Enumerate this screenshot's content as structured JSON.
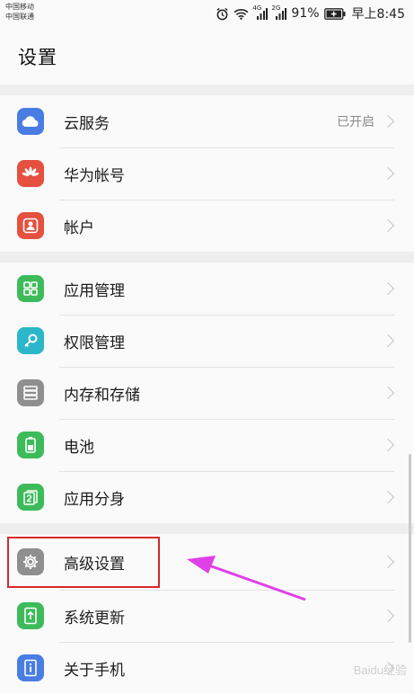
{
  "status_bar": {
    "carrier_1": "中国移动",
    "carrier_2": "中国联通",
    "net_1": "4G",
    "net_2": "2G",
    "battery_pct": "91%",
    "time": "早上8:45"
  },
  "header": {
    "title": "设置"
  },
  "groups": [
    {
      "items": [
        {
          "label": "云服务",
          "status": "已开启",
          "icon": "cloud-icon",
          "color": "#4a7de3"
        },
        {
          "label": "华为帐号",
          "status": "",
          "icon": "huawei-logo-icon",
          "color": "#e5503f"
        },
        {
          "label": "帐户",
          "status": "",
          "icon": "account-icon",
          "color": "#e5503f"
        }
      ]
    },
    {
      "items": [
        {
          "label": "应用管理",
          "status": "",
          "icon": "apps-grid-icon",
          "color": "#3dbb5a"
        },
        {
          "label": "权限管理",
          "status": "",
          "icon": "key-icon",
          "color": "#2bb7c9"
        },
        {
          "label": "内存和存储",
          "status": "",
          "icon": "storage-icon",
          "color": "#8f8f8f"
        },
        {
          "label": "电池",
          "status": "",
          "icon": "battery-icon",
          "color": "#3dbb5a"
        },
        {
          "label": "应用分身",
          "status": "",
          "icon": "app-twin-icon",
          "color": "#3dbb5a"
        }
      ]
    },
    {
      "items": [
        {
          "label": "高级设置",
          "status": "",
          "icon": "gear-icon",
          "color": "#8f8f8f"
        },
        {
          "label": "系统更新",
          "status": "",
          "icon": "system-update-icon",
          "color": "#3dbb5a"
        },
        {
          "label": "关于手机",
          "status": "",
          "icon": "about-phone-icon",
          "color": "#4a7de3"
        }
      ]
    }
  ],
  "annotation": {
    "color": "#d8292a",
    "arrow_color": "#e040e8"
  },
  "watermark": "Baidu经验"
}
